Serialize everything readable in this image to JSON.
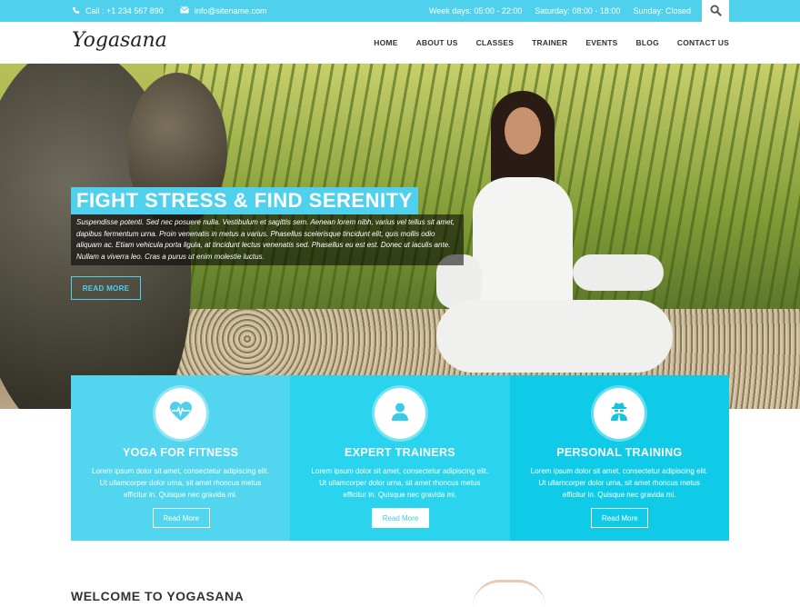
{
  "topbar": {
    "phone": "Call : +1 234 567 890",
    "email": "info@sitename.com",
    "hours_weekdays": "Week days: 05:00 - 22:00",
    "hours_saturday": "Saturday: 08:00 - 18:00",
    "hours_sunday": "Sunday: Closed"
  },
  "header": {
    "logo": "Yogasana",
    "nav": [
      "HOME",
      "ABOUT US",
      "CLASSES",
      "TRAINER",
      "EVENTS",
      "BLOG",
      "CONTACT US"
    ]
  },
  "hero": {
    "title": "FIGHT STRESS & FIND SERENITY",
    "text": "Suspendisse potenti. Sed nec posuere nulla. Vestibulum et sagittis sem. Aenean lorem nibh, varius vel tellus sit amet, dapibus fermentum urna. Proin venenatis in metus a varius. Phasellus scelerisque tincidunt elit, quis mollis odio aliquam ac. Etiam vehicula porta ligula, at tincidunt lectus venenatis sed. Phasellus eu est est. Donec ut iaculis ante. Nullam a viverra leo. Cras a purus ut enim molestie luctus.",
    "button": "READ MORE"
  },
  "features": [
    {
      "title": "YOGA FOR FITNESS",
      "text": "Lorem ipsum dolor sit amet, consectetur adipiscing elit. Ut ullamcorper dolor urna, sit amet rhoncus metus efficitur in. Quisque nec gravida mi.",
      "button": "Read More",
      "icon": "heart-pulse-icon"
    },
    {
      "title": "EXPERT TRAINERS",
      "text": "Lorem ipsum dolor sit amet, consectetur adipiscing elit. Ut ullamcorper dolor urna, sit amet rhoncus metus efficitur in. Quisque nec gravida mi.",
      "button": "Read More",
      "icon": "user-icon"
    },
    {
      "title": "PERSONAL TRAINING",
      "text": "Lorem ipsum dolor sit amet, consectetur adipiscing elit. Ut ullamcorper dolor urna, sit amet rhoncus metus efficitur in. Quisque nec gravida mi.",
      "button": "Read More",
      "icon": "user-secret-icon"
    }
  ],
  "welcome": {
    "title": "WELCOME TO YOGASANA"
  },
  "colors": {
    "accent": "#4fd1ee"
  }
}
